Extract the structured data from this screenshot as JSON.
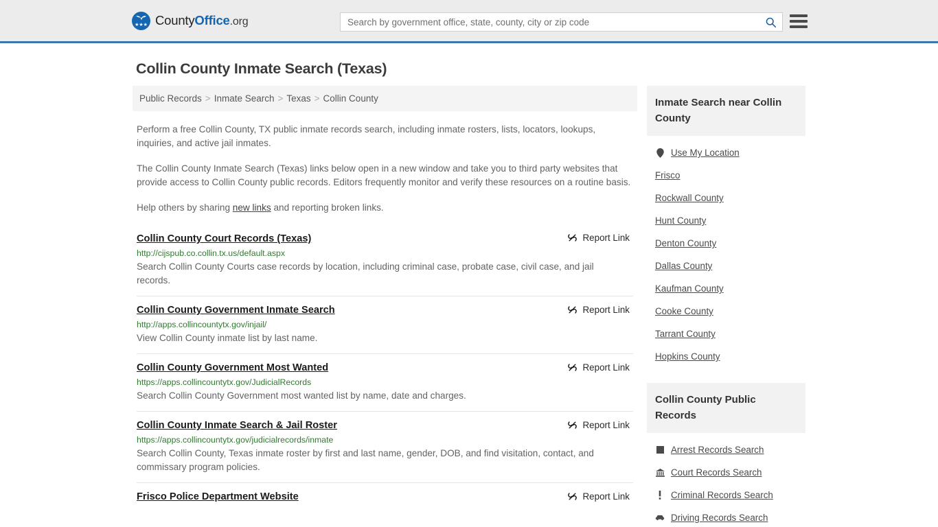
{
  "header": {
    "logo": {
      "part1": "County",
      "part2": "Office",
      "part3": ".org",
      "icon": "eagle-seal-icon",
      "stars": "★★★"
    },
    "search": {
      "placeholder": "Search by government office, state, county, city or zip code",
      "value": "",
      "icon": "search-icon"
    },
    "menu_icon": "hamburger-menu-icon",
    "accent_color": "#3b77ad"
  },
  "page": {
    "title": "Collin County Inmate Search (Texas)"
  },
  "breadcrumb": {
    "separator": ">",
    "items": [
      {
        "label": "Public Records"
      },
      {
        "label": "Inmate Search"
      },
      {
        "label": "Texas"
      },
      {
        "label": "Collin County"
      }
    ]
  },
  "intro": {
    "paragraph1": "Perform a free Collin County, TX public inmate records search, including inmate rosters, lists, locators, lookups, inquiries, and active jail inmates.",
    "paragraph2": "The Collin County Inmate Search (Texas) links below open in a new window and take you to third party websites that provide access to Collin County public records. Editors frequently monitor and verify these resources on a routine basis.",
    "paragraph3_before": "Help others by sharing ",
    "paragraph3_link": "new links",
    "paragraph3_after": " and reporting broken links."
  },
  "results": {
    "report_label": "Report Link",
    "report_icon": "broken-link-icon",
    "items": [
      {
        "title": "Collin County Court Records (Texas)",
        "url": "http://cijspub.co.collin.tx.us/default.aspx",
        "description": "Search Collin County Courts case records by location, including criminal case, probate case, civil case, and jail records."
      },
      {
        "title": "Collin County Government Inmate Search",
        "url": "http://apps.collincountytx.gov/injail/",
        "description": "View Collin County inmate list by last name."
      },
      {
        "title": "Collin County Government Most Wanted",
        "url": "https://apps.collincountytx.gov/JudicialRecords",
        "description": "Search Collin County Government most wanted list by name, date and charges."
      },
      {
        "title": "Collin County Inmate Search & Jail Roster",
        "url": "https://apps.collincountytx.gov/judicialrecords/inmate",
        "description": "Search Collin County, Texas inmate roster by first and last name, gender, DOB, and find visitation, contact, and commissary program policies."
      },
      {
        "title": "Frisco Police Department Website",
        "url": "",
        "description": ""
      }
    ]
  },
  "sidebar": {
    "nearby": {
      "heading": "Inmate Search near Collin County",
      "items": [
        {
          "label": "Use My Location",
          "icon": "map-pin-icon"
        },
        {
          "label": "Frisco",
          "icon": ""
        },
        {
          "label": "Rockwall County",
          "icon": ""
        },
        {
          "label": "Hunt County",
          "icon": ""
        },
        {
          "label": "Denton County",
          "icon": ""
        },
        {
          "label": "Dallas County",
          "icon": ""
        },
        {
          "label": "Kaufman County",
          "icon": ""
        },
        {
          "label": "Cooke County",
          "icon": ""
        },
        {
          "label": "Tarrant County",
          "icon": ""
        },
        {
          "label": "Hopkins County",
          "icon": ""
        }
      ]
    },
    "public_records": {
      "heading": "Collin County Public Records",
      "items": [
        {
          "label": "Arrest Records Search",
          "icon": "fingerprint-icon"
        },
        {
          "label": "Court Records Search",
          "icon": "courthouse-icon"
        },
        {
          "label": "Criminal Records Search",
          "icon": "exclamation-icon"
        },
        {
          "label": "Driving Records Search",
          "icon": "car-icon"
        }
      ]
    }
  }
}
